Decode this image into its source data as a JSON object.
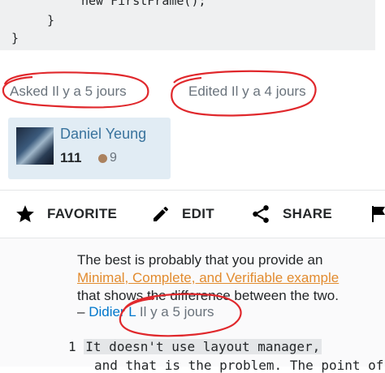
{
  "code": {
    "lines": [
      "new FirstFrame();",
      "}",
      "}"
    ]
  },
  "post_meta": {
    "asked": "Asked Il y a 5 jours",
    "edited": "Edited Il y a 4 jours"
  },
  "user": {
    "name": "Daniel Yeung",
    "reputation": "111",
    "bronze_badges": "9"
  },
  "toolbar": {
    "favorite": "FAVORITE",
    "edit": "EDIT",
    "share": "SHARE"
  },
  "comment": {
    "line1": "The best is probably that you provide an",
    "link": "Minimal, Complete, and Verifiable example",
    "line3": "that shows the difference between the two.",
    "dash": "– ",
    "user": "Didier L",
    "time": " Il y a 5 jours"
  },
  "answer": {
    "number": "1",
    "line1": "It doesn't use layout manager,",
    "line2": "and that is the problem. The point of"
  },
  "colors": {
    "annotation_red": "#e0282c",
    "user_card_bg": "#e1ecf4",
    "link_orange": "#e28b2e",
    "user_blue": "#0077cc"
  }
}
